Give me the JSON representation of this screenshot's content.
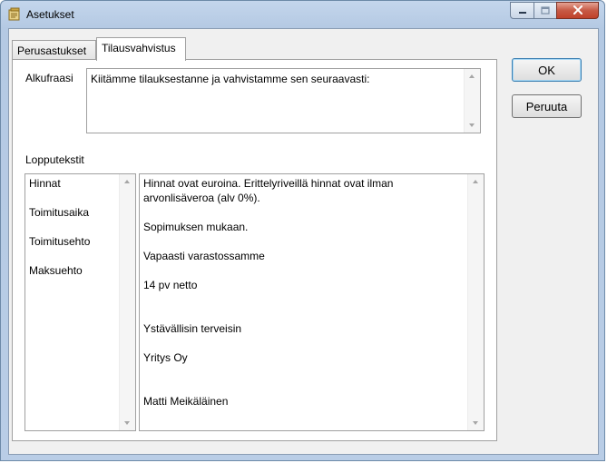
{
  "window": {
    "title": "Asetukset"
  },
  "tabs": [
    {
      "label": "Perusastukset"
    },
    {
      "label": "Tilausvahvistus"
    }
  ],
  "alkufraasi": {
    "label": "Alkufraasi",
    "value": "Kiitämme tilauksestanne ja vahvistamme sen seuraavasti:"
  },
  "lopputekstit": {
    "label": "Lopputekstit",
    "items": [
      "Hinnat",
      "Toimitusaika",
      "Toimitusehto",
      "Maksuehto"
    ],
    "text_lines": [
      "Hinnat ovat euroina. Erittelyriveillä hinnat ovat ilman",
      "arvonlisäveroa (alv 0%).",
      "Sopimuksen mukaan.",
      "Vapaasti varastossamme",
      "14 pv netto",
      "Ystävällisin terveisin",
      "Yritys Oy",
      "Matti Meikäläinen"
    ]
  },
  "buttons": {
    "ok": "OK",
    "cancel": "Peruuta"
  },
  "icons": {
    "app": "settings-app-icon",
    "minimize": "minimize-icon",
    "maximize": "maximize-icon",
    "close": "close-icon"
  }
}
